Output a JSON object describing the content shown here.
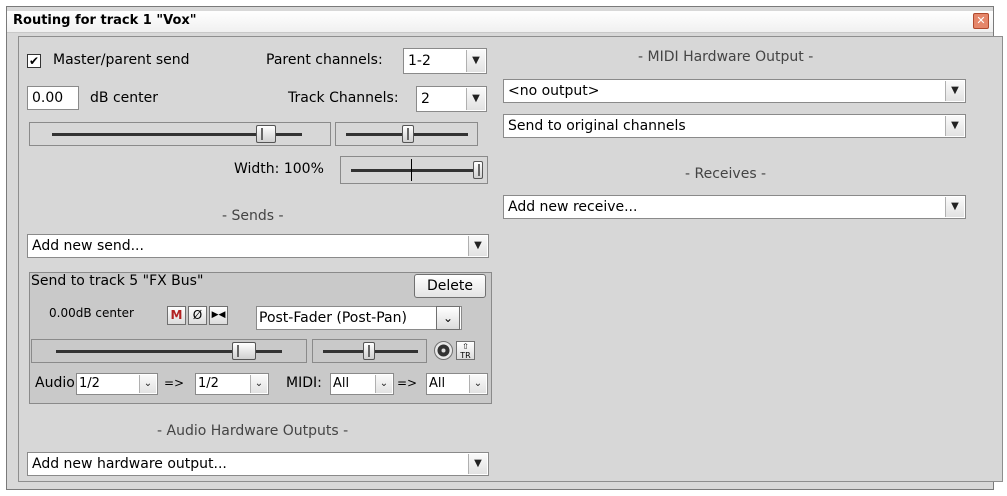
{
  "window": {
    "title": "Routing for track 1 \"Vox\"",
    "close_glyph": "✕"
  },
  "left": {
    "master_send_checked": true,
    "master_send_label": "Master/parent send",
    "parent_channels_label": "Parent channels:",
    "parent_channels_value": "1-2",
    "volume_value": "0.00",
    "volume_unit": "dB  center",
    "track_channels_label": "Track Channels:",
    "track_channels_value": "2",
    "width_label": "Width: 100%",
    "sends_header": "- Sends -",
    "add_send_label": "Add new send...",
    "send": {
      "title": "Send to track 5 \"FX Bus\"",
      "delete_label": "Delete",
      "level_text": "0.00dB center",
      "mute_label": "M",
      "phase_label": "Ø",
      "mono_label": "▶◀",
      "mode_value": "Post-Fader (Post-Pan)",
      "audio_label": "Audio:",
      "audio_src": "1/2",
      "arrow": "=>",
      "audio_dst": "1/2",
      "midi_label": "MIDI:",
      "midi_src": "All",
      "midi_dst": "All"
    },
    "hw_out_header": "- Audio Hardware Outputs -",
    "add_hw_label": "Add new hardware output..."
  },
  "right": {
    "midi_hw_header": "- MIDI Hardware Output -",
    "midi_output_value": "<no output>",
    "midi_channel_value": "Send to original channels",
    "receives_header": "- Receives -",
    "add_receive_label": "Add new receive..."
  },
  "colors": {
    "mute_red": "#b22222",
    "panel": "#d7d7d7"
  },
  "icons": {
    "dropdown": "chevron-down-icon",
    "fx": "fx-icon",
    "tr": "track-icon",
    "close": "close-icon"
  }
}
